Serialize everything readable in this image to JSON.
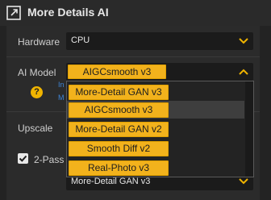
{
  "header": {
    "title": "More Details AI",
    "icon": "expand-window-icon"
  },
  "hardware": {
    "label": "Hardware",
    "value": "CPU"
  },
  "ai_model": {
    "label": "AI Model",
    "selected": "AIGCsmooth  v3"
  },
  "info_fragments": [
    "In",
    "M"
  ],
  "upscale": {
    "label": "Upscale"
  },
  "two_pass": {
    "label": "2-Pass",
    "checked": true
  },
  "second_select": {
    "value": "More-Detail GAN  v3"
  },
  "dropdown": {
    "options": [
      {
        "label": "More-Detail GAN  v3",
        "highlighted": false
      },
      {
        "label": "AIGCsmooth  v3",
        "highlighted": true
      },
      {
        "label": "More-Detail GAN  v2",
        "highlighted": false
      },
      {
        "label": "Smooth Diff  v2",
        "highlighted": false
      },
      {
        "label": "Real-Photo  v3",
        "highlighted": false
      }
    ]
  },
  "colors": {
    "accent": "#f2b21c",
    "link": "#3f86d8",
    "background": "#232323"
  }
}
